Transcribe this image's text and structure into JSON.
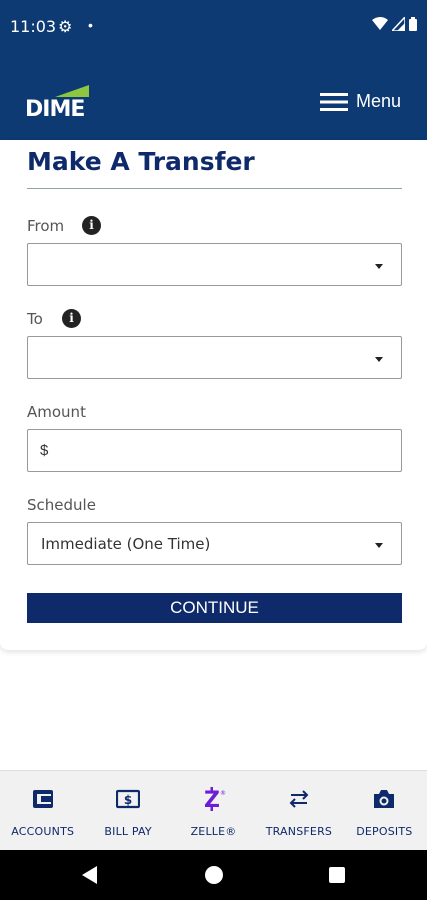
{
  "status": {
    "time": "11:03"
  },
  "header": {
    "logo_text": "DIME",
    "menu_label": "Menu"
  },
  "form": {
    "title": "Make A Transfer",
    "from_label": "From",
    "from_value": "",
    "to_label": "To",
    "to_value": "",
    "amount_label": "Amount",
    "amount_prefix": "$",
    "amount_value": "",
    "schedule_label": "Schedule",
    "schedule_value": "Immediate (One Time)",
    "continue_label": "CONTINUE"
  },
  "bottom_nav": {
    "items": [
      {
        "label": "ACCOUNTS",
        "icon": "wallet-icon"
      },
      {
        "label": "BILL PAY",
        "icon": "bill-icon"
      },
      {
        "label": "ZELLE®",
        "icon": "zelle-icon"
      },
      {
        "label": "TRANSFERS",
        "icon": "transfer-arrows-icon"
      },
      {
        "label": "DEPOSITS",
        "icon": "camera-icon"
      }
    ]
  },
  "colors": {
    "brand_navy": "#0d3a73",
    "button_navy": "#0f2a6b",
    "logo_green": "#8dc63f",
    "zelle_purple": "#6d1ed4"
  }
}
